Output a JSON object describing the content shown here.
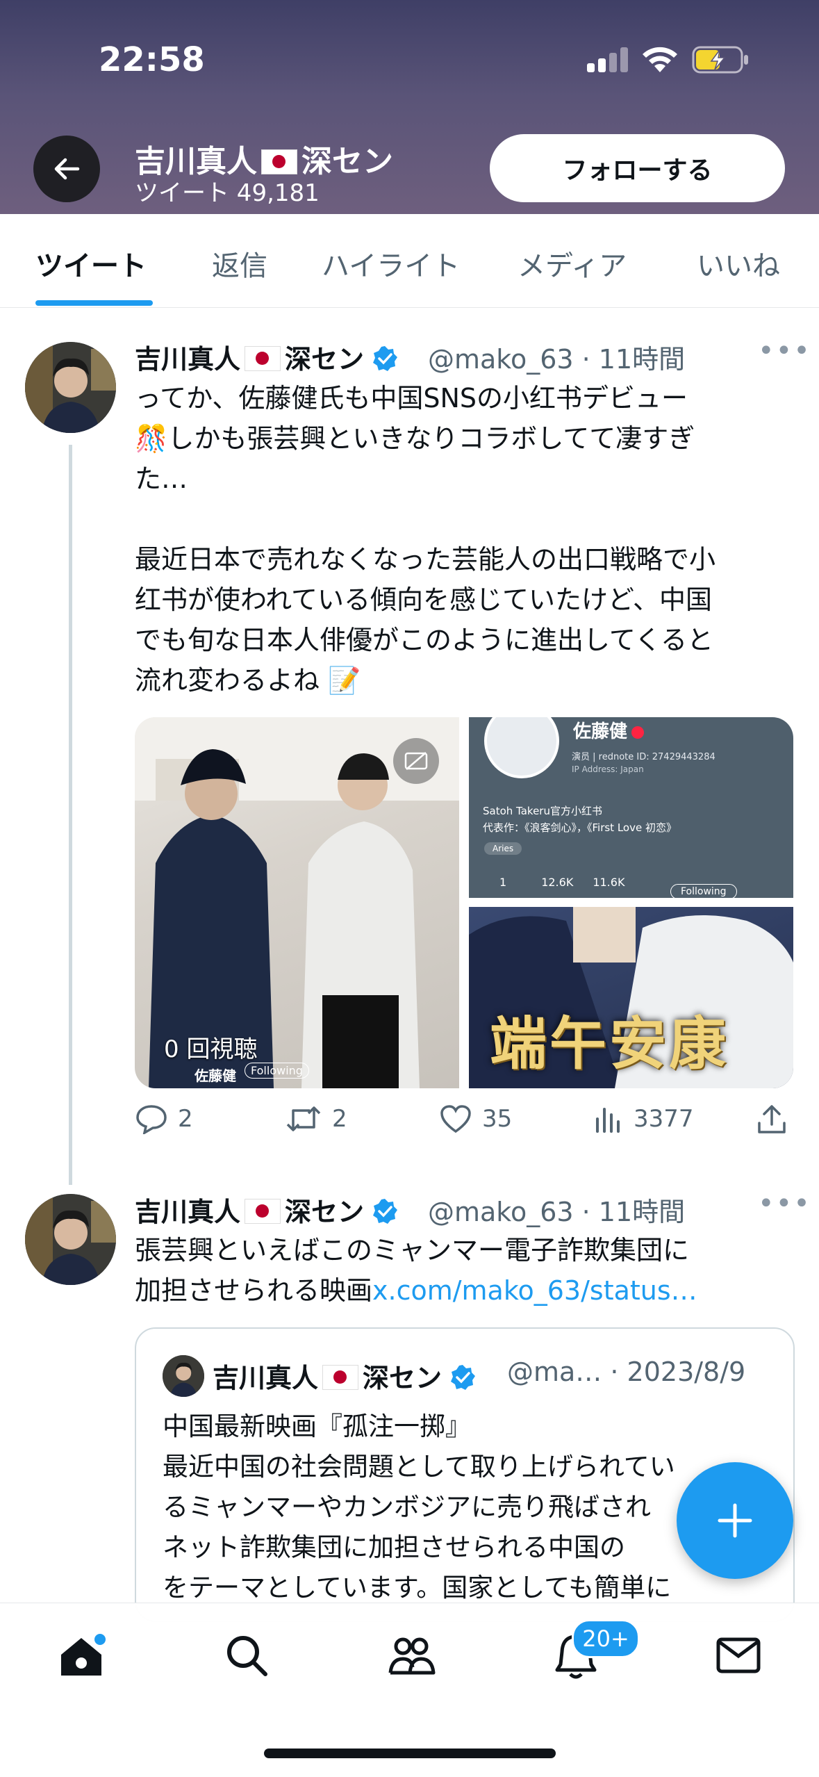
{
  "status_bar": {
    "time": "22:58"
  },
  "header": {
    "name": "吉川真人",
    "name_suffix": "深セン",
    "tweet_count_label": "ツイート 49,181",
    "follow_button": "フォローする"
  },
  "tabs": [
    {
      "label": "ツイート",
      "active": true
    },
    {
      "label": "返信"
    },
    {
      "label": "ハイライト"
    },
    {
      "label": "メディア"
    },
    {
      "label": "いいね"
    }
  ],
  "tweet1": {
    "name": "吉川真人",
    "name_suffix": "深セン",
    "handle_time": "@mako_63 · 11時間",
    "text_line1": "ってか、佐藤健氏も中国SNSの小红书デビュー",
    "text_line2": "しかも張芸興といきなりコラボしてて凄すぎ",
    "text_line3": "た…",
    "text_para2": "最近日本で売れなくなった芸能人の出口戦略で小\n红书が使われている傾向を感じていたけど、中国\nでも旬な日本人俳優がこのように進出してくると\n流れ変わるよね",
    "media": {
      "video_views": "0 回視聴",
      "video_user": "佐藤健",
      "video_following": "Following",
      "profile_name": "佐藤健",
      "profile_role": "演员",
      "profile_id": "rednote ID: 27429443284",
      "profile_ip": "IP Address: Japan",
      "profile_bio": "Satoh Takeru官方小红书",
      "profile_works": "代表作：《浪客剑心》，《First Love 初恋》",
      "profile_tag": "Aries",
      "profile_stat1": "1",
      "profile_stat2": "12.6K",
      "profile_stat3": "11.6K",
      "profile_following": "Following",
      "image3_text": "端午安康"
    },
    "replies": "2",
    "retweets": "2",
    "likes": "35",
    "views": "3377"
  },
  "tweet2": {
    "name": "吉川真人",
    "name_suffix": "深セン",
    "handle_time": "@mako_63 · 11時間",
    "text": "張芸興といえばこのミャンマー電子詐欺集団に\n加担させられる映画",
    "link": "x.com/mako_63/status…",
    "quote": {
      "name": "吉川真人",
      "name_suffix": "深セン",
      "handle_date": "@ma… · 2023/8/9",
      "text": "中国最新映画『孤注一掷』\n最近中国の社会問題として取り上げられてい\nるミャンマーやカンボジアに売り飛ばされ\nネット詐欺集団に加担させられる中国の\nをテーマとしています。国家としても簡単に"
    }
  },
  "nav": {
    "notifications_badge": "20+"
  },
  "colors": {
    "accent": "#1d9bf0",
    "text": "#0f1419",
    "muted": "#536471"
  }
}
